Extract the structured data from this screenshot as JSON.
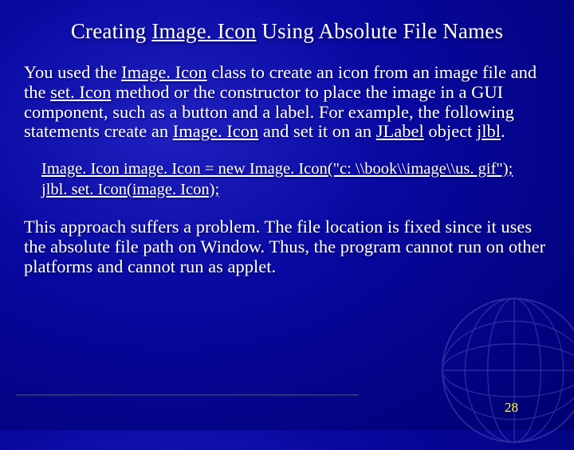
{
  "title": {
    "t1": "Creating ",
    "t2": "Image. Icon",
    "t3": " Using Absolute File Names"
  },
  "p1": {
    "s1": "You used the ",
    "s2": "Image. Icon",
    "s3": " class to create an icon from an image file and the ",
    "s4": "set. Icon",
    "s5": " method or the constructor to place the image in a GUI component, such as a button and a label. For example, the following statements create an ",
    "s6": "Image. Icon",
    "s7": " and set it on an ",
    "s8": "JLabel",
    "s9": " object ",
    "s10": "jlbl",
    "s11": "."
  },
  "code": {
    "line1": "Image. Icon image. Icon = new Image. Icon(\"c: \\\\book\\\\image\\\\us. gif\");",
    "line2": "jlbl. set. Icon(image. Icon);"
  },
  "p2": "This approach suffers a problem. The file location is fixed since it uses the absolute file path on Window. Thus, the program cannot run on other platforms and cannot run as applet.",
  "pagenum": "28"
}
